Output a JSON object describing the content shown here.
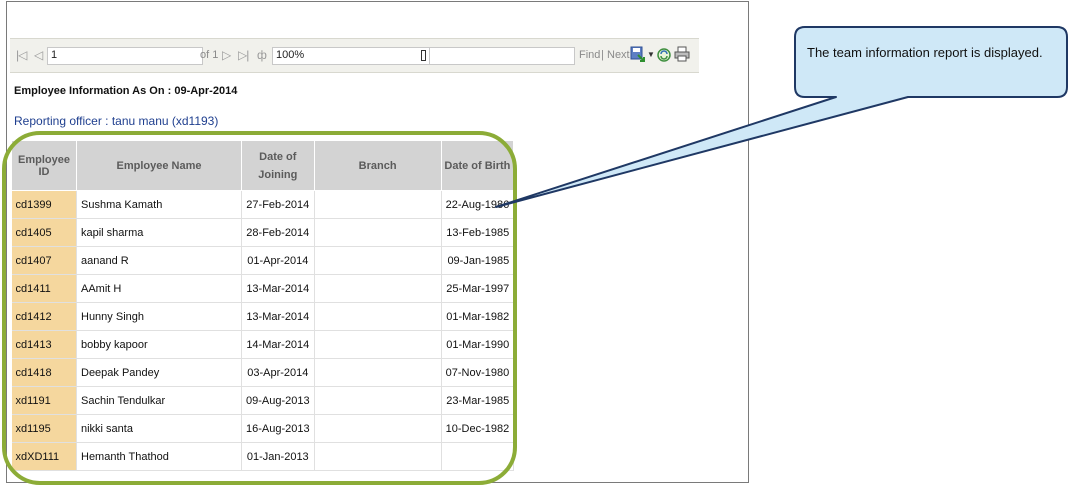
{
  "toolbar": {
    "page_value": "1",
    "of_pages": "of 1",
    "zoom_value": "100%",
    "find_label": "Find",
    "separator": "|",
    "next_label": "Next",
    "icons": [
      "first-page-icon",
      "previous-page-icon",
      "next-page-icon",
      "last-page-icon",
      "refresh-arrow-icon",
      "export-icon",
      "dropdown-arrow-icon",
      "refresh-icon",
      "print-icon"
    ]
  },
  "report": {
    "title": "Employee Information As On : 09-Apr-2014",
    "officer": "Reporting officer : tanu manu (xd1193)",
    "columns": [
      "Employee ID",
      "Employee Name",
      "Date of Joining",
      "Branch",
      "Date of Birth"
    ],
    "rows": [
      [
        "cd1399",
        "Sushma Kamath",
        "27-Feb-2014",
        "",
        "22-Aug-1986"
      ],
      [
        "cd1405",
        "kapil sharma",
        "28-Feb-2014",
        "",
        "13-Feb-1985"
      ],
      [
        "cd1407",
        "aanand R",
        "01-Apr-2014",
        "",
        "09-Jan-1985"
      ],
      [
        "cd1411",
        "AAmit H",
        "13-Mar-2014",
        "",
        "25-Mar-1997"
      ],
      [
        "cd1412",
        "Hunny Singh",
        "13-Mar-2014",
        "",
        "01-Mar-1982"
      ],
      [
        "cd1413",
        "bobby kapoor",
        "14-Mar-2014",
        "",
        "01-Mar-1990"
      ],
      [
        "cd1418",
        "Deepak Pandey",
        "03-Apr-2014",
        "",
        "07-Nov-1980"
      ],
      [
        "xd1191",
        "Sachin Tendulkar",
        "09-Aug-2013",
        "",
        "23-Mar-1985"
      ],
      [
        "xd1195",
        "nikki santa",
        "16-Aug-2013",
        "",
        "10-Dec-1982"
      ],
      [
        "xdXD111",
        "Hemanth Thathod",
        "01-Jan-2013",
        "",
        ""
      ]
    ]
  },
  "callout": {
    "text": "The team information report  is displayed."
  },
  "colors": {
    "highlight": "#8cac37",
    "callout_fill": "#cfe8f7",
    "callout_border": "#1f3864",
    "id_cell": "#f5d79e",
    "header_bg": "#d3d3d3"
  }
}
